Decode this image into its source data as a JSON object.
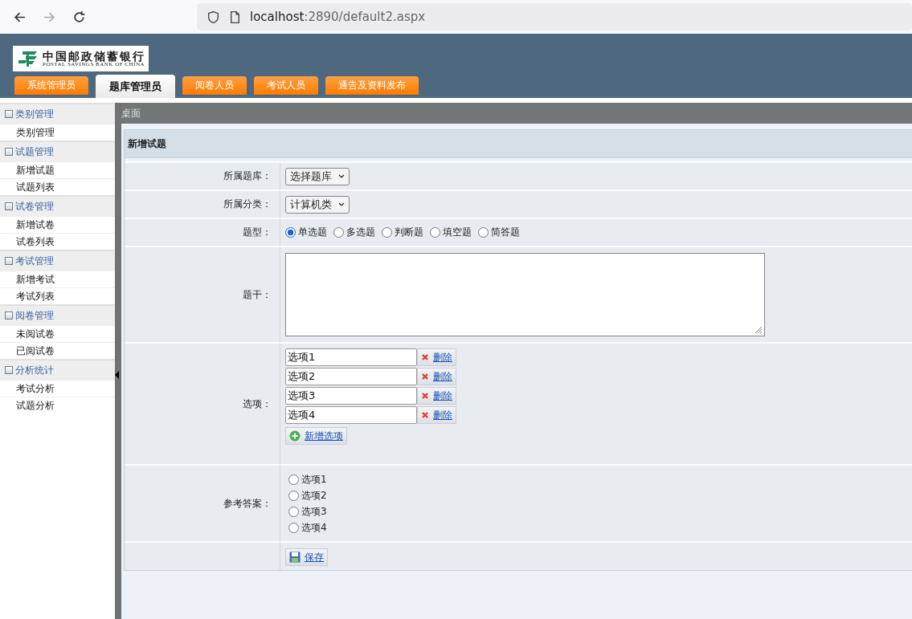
{
  "browser": {
    "url_host": "localhost",
    "url_rest": ":2890/default2.aspx"
  },
  "header": {
    "logo": {
      "name_cn": "中国邮政储蓄银行",
      "name_en": "POSTAL SAVINGS BANK OF CHINA"
    },
    "tabs": [
      {
        "label": "系统管理员",
        "selected": false
      },
      {
        "label": "题库管理员",
        "selected": true
      },
      {
        "label": "阅卷人员",
        "selected": false
      },
      {
        "label": "考试人员",
        "selected": false
      },
      {
        "label": "通告及资料发布",
        "selected": false
      }
    ]
  },
  "sidebar": {
    "groups": [
      {
        "title": "类别管理",
        "children": [
          {
            "label": "类别管理"
          }
        ]
      },
      {
        "title": "试题管理",
        "children": [
          {
            "label": "新增试题"
          },
          {
            "label": "试题列表"
          }
        ]
      },
      {
        "title": "试卷管理",
        "children": [
          {
            "label": "新增试卷"
          },
          {
            "label": "试卷列表"
          }
        ]
      },
      {
        "title": "考试管理",
        "children": [
          {
            "label": "新增考试"
          },
          {
            "label": "考试列表"
          }
        ]
      },
      {
        "title": "阅卷管理",
        "children": [
          {
            "label": "未阅试卷"
          },
          {
            "label": "已阅试卷"
          }
        ]
      },
      {
        "title": "分析统计",
        "children": [
          {
            "label": "考试分析"
          },
          {
            "label": "试题分析"
          }
        ]
      }
    ]
  },
  "breadcrumb": "桌面",
  "form": {
    "title": "新增试题",
    "rows": [
      {
        "kind": "select",
        "label": "所属题库：",
        "value": "选择题库"
      },
      {
        "kind": "select",
        "label": "所属分类：",
        "value": "计算机类"
      },
      {
        "kind": "radio",
        "label": "题型：",
        "options": [
          {
            "label": "单选题",
            "selected": true
          },
          {
            "label": "多选题",
            "selected": false
          },
          {
            "label": "判断题",
            "selected": false
          },
          {
            "label": "填空题",
            "selected": false
          },
          {
            "label": "简答题",
            "selected": false
          }
        ]
      },
      {
        "kind": "textarea",
        "label": "题干："
      },
      {
        "kind": "options",
        "label": "选项：",
        "items": [
          {
            "value": "选项1",
            "action": "删除"
          },
          {
            "value": "选项2",
            "action": "删除"
          },
          {
            "value": "选项3",
            "action": "删除"
          },
          {
            "value": "选项4",
            "action": "删除"
          }
        ],
        "add": "新增选项"
      },
      {
        "kind": "answer",
        "label": "参考答案：",
        "options": [
          {
            "label": "选项1",
            "selected": false
          },
          {
            "label": "选项2",
            "selected": false
          },
          {
            "label": "选项3",
            "selected": false
          },
          {
            "label": "选项4",
            "selected": false
          }
        ]
      },
      {
        "kind": "save",
        "button": "保存"
      }
    ]
  }
}
